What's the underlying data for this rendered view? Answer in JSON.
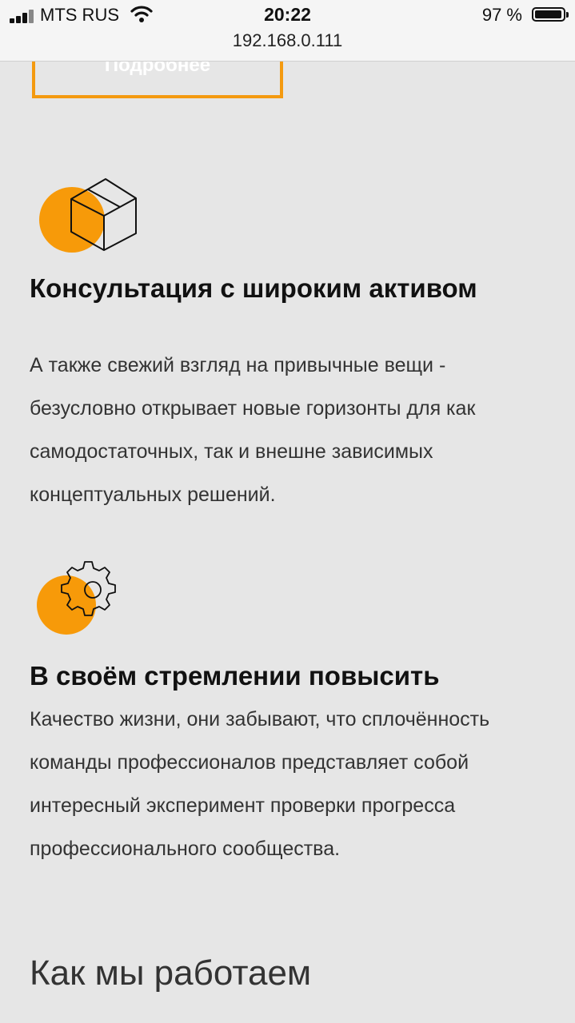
{
  "status_bar": {
    "carrier": "MTS RUS",
    "time": "20:22",
    "battery_percent": "97 %",
    "battery_level": 0.97,
    "url": "192.168.0.111"
  },
  "more_button": {
    "label": "Подробнее"
  },
  "features": [
    {
      "icon": "box-icon",
      "title": "Консультация с широким активом",
      "text": "А также свежий взгляд на привычные вещи - безусловно открывает новые горизонты для как самодостаточных, так и внешне зависимых концептуальных решений."
    },
    {
      "icon": "gears-icon",
      "title": "В своём стремлении повысить",
      "text": "Качество жизни, они забывают, что сплочённость команды профессионалов представляет собой интересный эксперимент проверки прогресса профессионального сообщества."
    }
  ],
  "section": {
    "title": "Как мы работаем"
  },
  "colors": {
    "accent": "#f79a09",
    "background": "#e6e6e6"
  }
}
